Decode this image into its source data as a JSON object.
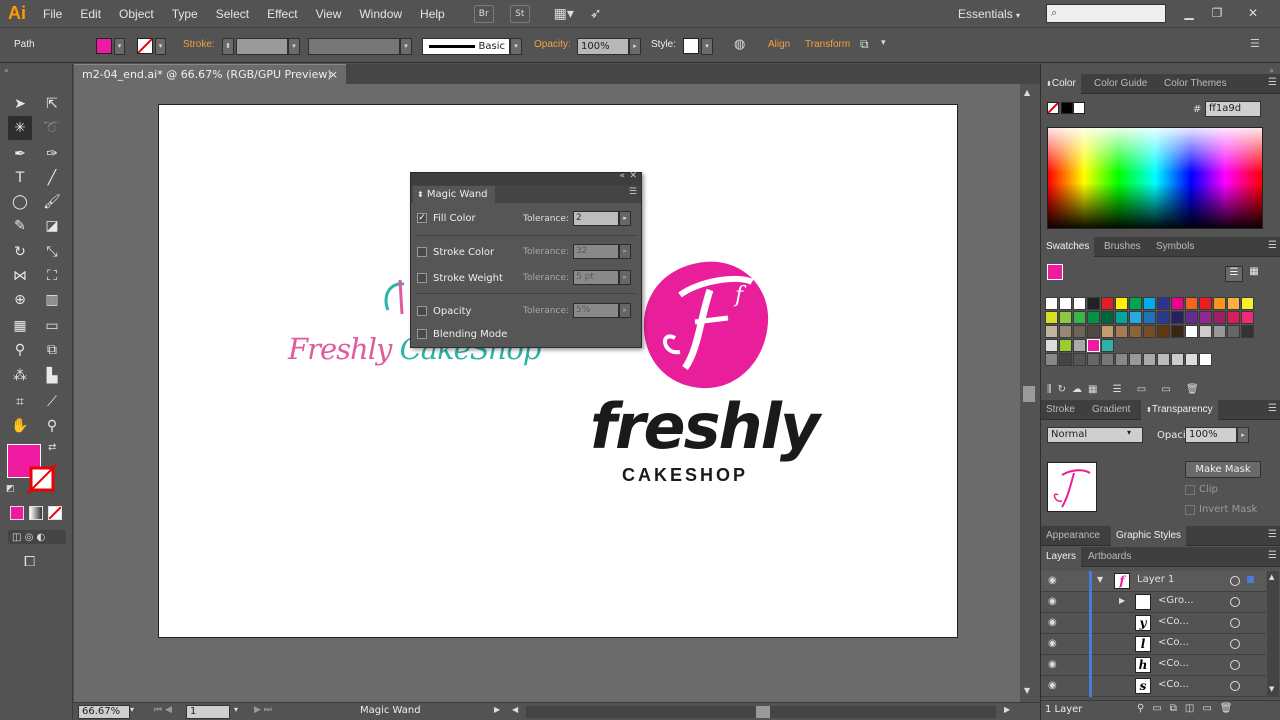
{
  "app": {
    "logo": "Ai"
  },
  "menu": [
    "File",
    "Edit",
    "Object",
    "Type",
    "Select",
    "Effect",
    "View",
    "Window",
    "Help"
  ],
  "menubar_buttons": {
    "br": "Br",
    "st": "St"
  },
  "workspace": "Essentials",
  "control_bar": {
    "selection_type": "Path",
    "stroke_label": "Stroke:",
    "brush_label": "Basic",
    "opacity_label": "Opacity:",
    "opacity_value": "100%",
    "style_label": "Style:",
    "align_label": "Align",
    "transform_label": "Transform",
    "fill_color": "#ee1aa0"
  },
  "document_tab": {
    "title": "m2-04_end.ai* @ 66.67% (RGB/GPU Preview)",
    "close": "×"
  },
  "magic_wand": {
    "title": "Magic Wand",
    "rows": [
      {
        "label": "Fill Color",
        "checked": true,
        "tolerance_label": "Tolerance:",
        "tolerance": "2"
      },
      {
        "label": "Stroke Color",
        "checked": false,
        "tolerance_label": "Tolerance:",
        "tolerance": "32"
      },
      {
        "label": "Stroke Weight",
        "checked": false,
        "tolerance_label": "Tolerance:",
        "tolerance": "5 pt"
      },
      {
        "label": "Opacity",
        "checked": false,
        "tolerance_label": "Tolerance:",
        "tolerance": "5%"
      },
      {
        "label": "Blending Mode",
        "checked": false
      }
    ]
  },
  "artwork": {
    "script_logo_part1": "Freshly ",
    "script_logo_part2": "CakeShop",
    "main_logo_word": "freshly",
    "main_logo_sub": "CAKESHOP",
    "badge_letter": "f",
    "brand_pink": "#e91e9a"
  },
  "status_bar": {
    "zoom": "66.67%",
    "artboard": "1",
    "tool": "Magic Wand"
  },
  "color_panel": {
    "tabs": [
      "Color",
      "Color Guide",
      "Color Themes"
    ],
    "hex_label": "#",
    "hex_value": "ff1a9d"
  },
  "swatches_panel": {
    "tabs": [
      "Swatches",
      "Brushes",
      "Symbols"
    ]
  },
  "transparency_panel": {
    "tabs": [
      "Stroke",
      "Gradient",
      "Transparency"
    ],
    "blend_mode": "Normal",
    "opacity_label": "Opacity:",
    "opacity_value": "100%",
    "make_mask": "Make Mask",
    "clip": "Clip",
    "invert_mask": "Invert Mask"
  },
  "appearance_tabs": [
    "Appearance",
    "Graphic Styles"
  ],
  "layers_panel": {
    "tabs": [
      "Layers",
      "Artboards"
    ],
    "rows": [
      {
        "name": "Layer 1",
        "thumb": "f"
      },
      {
        "name": "<Gro...",
        "thumb": ""
      },
      {
        "name": "<Co...",
        "thumb": "y"
      },
      {
        "name": "<Co...",
        "thumb": "l"
      },
      {
        "name": "<Co...",
        "thumb": "h"
      },
      {
        "name": "<Co...",
        "thumb": "s"
      }
    ],
    "footer": "1 Layer"
  }
}
